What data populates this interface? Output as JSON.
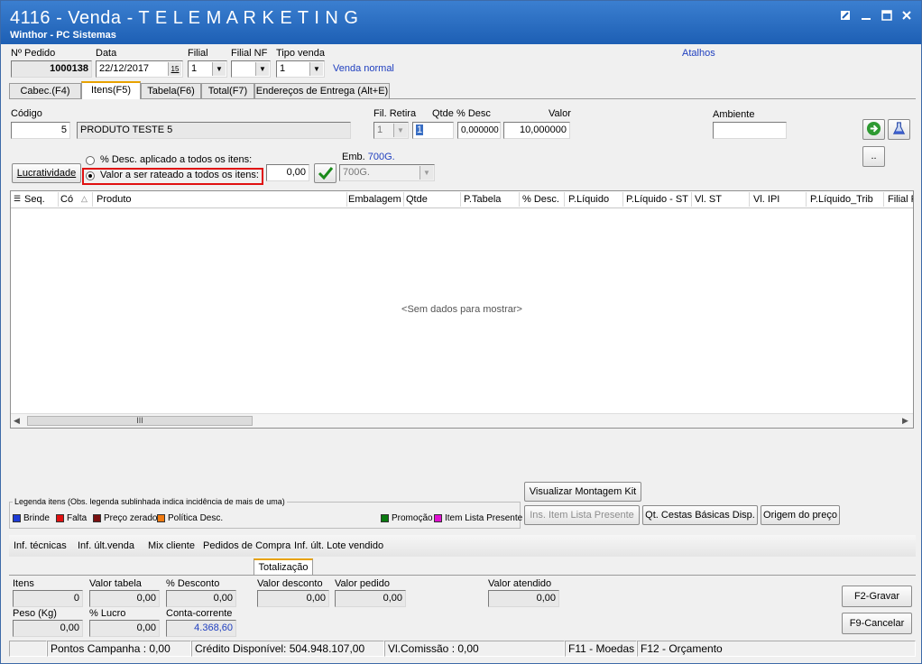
{
  "window": {
    "title": "4116 - Venda - T E L E M A R K E T I N G",
    "subtitle": "Winthor - PC Sistemas"
  },
  "header": {
    "pedido_label": "Nº Pedido",
    "pedido_value": "1000138",
    "data_label": "Data",
    "data_value": "22/12/2017",
    "calendar_glyph": "15",
    "filial_label": "Filial",
    "filial_value": "1",
    "filialnf_label": "Filial NF",
    "filialnf_value": "",
    "tipovenda_label": "Tipo venda",
    "tipovenda_value": "1",
    "tipovenda_desc": "Venda normal",
    "atalhos": "Atalhos"
  },
  "tabs": [
    {
      "label": "Cabec.(F4)"
    },
    {
      "label": "Itens(F5)"
    },
    {
      "label": "Tabela(F6)"
    },
    {
      "label": "Total(F7)"
    },
    {
      "label": "Endereços de Entrega (Alt+E)"
    }
  ],
  "item": {
    "codigo_label": "Código",
    "codigo_value": "5",
    "produto_value": "PRODUTO TESTE 5",
    "filretira_label": "Fil. Retira",
    "filretira_value": "1",
    "qtde_label": "Qtde",
    "qtde_value": "1",
    "desc_label": "% Desc",
    "desc_value": "0,000000",
    "valor_label": "Valor",
    "valor_value": "10,000000",
    "ambiente_label": "Ambiente",
    "ambiente_value": "",
    "more_button": "..",
    "lucratividade_button": "Lucratividade",
    "radio_desc_label": "% Desc. aplicado a todos os itens:",
    "radio_valor_label": "Valor a ser rateado a todos os itens:",
    "rateio_value": "0,00",
    "emb_label": "Emb.",
    "emb_link": "700G.",
    "emb_value": "700G."
  },
  "grid": {
    "columns": [
      "Seq.",
      "Cód",
      "Produto",
      "Embalagem",
      "Qtde",
      "P.Tabela",
      "% Desc.",
      "P.Líquido",
      "P.Líquido - ST",
      "Vl. ST",
      "Vl. IPI",
      "P.Líquido_Trib",
      "Filial R"
    ],
    "empty_text": "<Sem dados para mostrar>",
    "scroll_grip": "III"
  },
  "actions": {
    "visualizar_montagem": "Visualizar Montagem Kit",
    "ins_item_lista": "Ins. Item Lista Presente",
    "qt_cestas": "Qt. Cestas Básicas Disp.",
    "origem_preco": "Origem do preço"
  },
  "legend": {
    "title": "Legenda itens (Obs. legenda sublinhada indica incidência de mais de uma)",
    "items": [
      {
        "label": "Brinde",
        "color": "#1e3bd6"
      },
      {
        "label": "Falta",
        "color": "#e01010"
      },
      {
        "label": "Preço zerado",
        "color": "#7a1010"
      },
      {
        "label": "Política Desc.",
        "color": "#f07a10"
      },
      {
        "label": "Promoção",
        "color": "#0a7a10"
      },
      {
        "label": "Item Lista Presente",
        "color": "#e010d0"
      }
    ]
  },
  "info_links": [
    "Inf. técnicas",
    "Inf. últ.venda",
    "Mix cliente",
    "Pedidos de Compra",
    "Inf. últ. Lote vendido"
  ],
  "totals": {
    "tab_label": "Totalização",
    "itens_label": "Itens",
    "itens_value": "0",
    "valor_tabela_label": "Valor tabela",
    "valor_tabela_value": "0,00",
    "pct_desconto_label": "% Desconto",
    "pct_desconto_value": "0,00",
    "valor_desconto_label": "Valor desconto",
    "valor_desconto_value": "0,00",
    "valor_pedido_label": "Valor pedido",
    "valor_pedido_value": "0,00",
    "valor_atendido_label": "Valor atendido",
    "valor_atendido_value": "0,00",
    "peso_label": "Peso (Kg)",
    "peso_value": "0,00",
    "pct_lucro_label": "% Lucro",
    "pct_lucro_value": "0,00",
    "conta_corrente_label": "Conta-corrente",
    "conta_corrente_value": "4.368,60",
    "gravar_button": "F2-Gravar",
    "cancelar_button": "F9-Cancelar"
  },
  "status": {
    "pontos": "Pontos Campanha : 0,00",
    "credito": "Crédito Disponível: 504.948.107,00",
    "comissao": "Vl.Comissão : 0,00",
    "moedas": "F11 - Moedas",
    "orcamento": "F12 - Orçamento"
  }
}
